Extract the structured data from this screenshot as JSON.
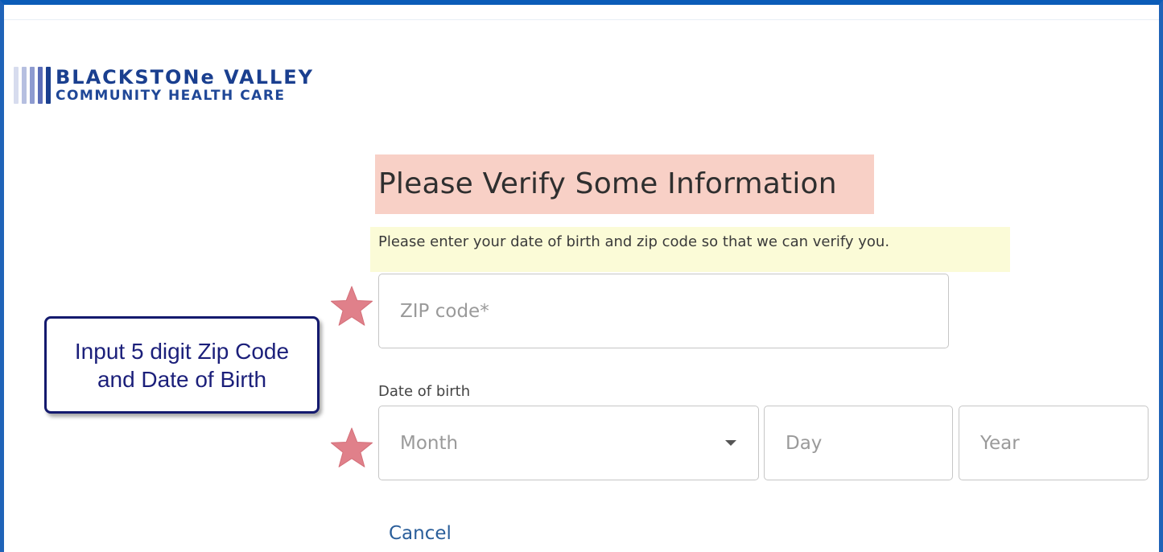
{
  "brand": {
    "line1": "BLACKSTONe VALLEY",
    "line2": "COMMUNITY HEALTH CARE",
    "bar_colors": [
      "#d7dcee",
      "#b6bfe0",
      "#8e9bd0",
      "#5b6db8",
      "#1a3f8f"
    ]
  },
  "form": {
    "heading": "Please Verify Some Information",
    "subtext": "Please enter your date of birth and zip code so that we can verify you.",
    "zip": {
      "placeholder": "ZIP code*",
      "value": ""
    },
    "dob": {
      "label": "Date of birth",
      "month": {
        "placeholder": "Month",
        "value": ""
      },
      "day": {
        "placeholder": "Day",
        "value": ""
      },
      "year": {
        "placeholder": "Year",
        "value": ""
      }
    },
    "cancel_label": "Cancel"
  },
  "annotation": {
    "callout_text": "Input 5 digit Zip Code and Date of Birth",
    "star_color": "#e0808a",
    "heading_highlight": "#f8d0c6",
    "subtext_highlight": "#fbfbd7"
  },
  "colors": {
    "frame": "#0b5cb8",
    "link": "#2a5e9a",
    "brand": "#1a3f8f"
  }
}
